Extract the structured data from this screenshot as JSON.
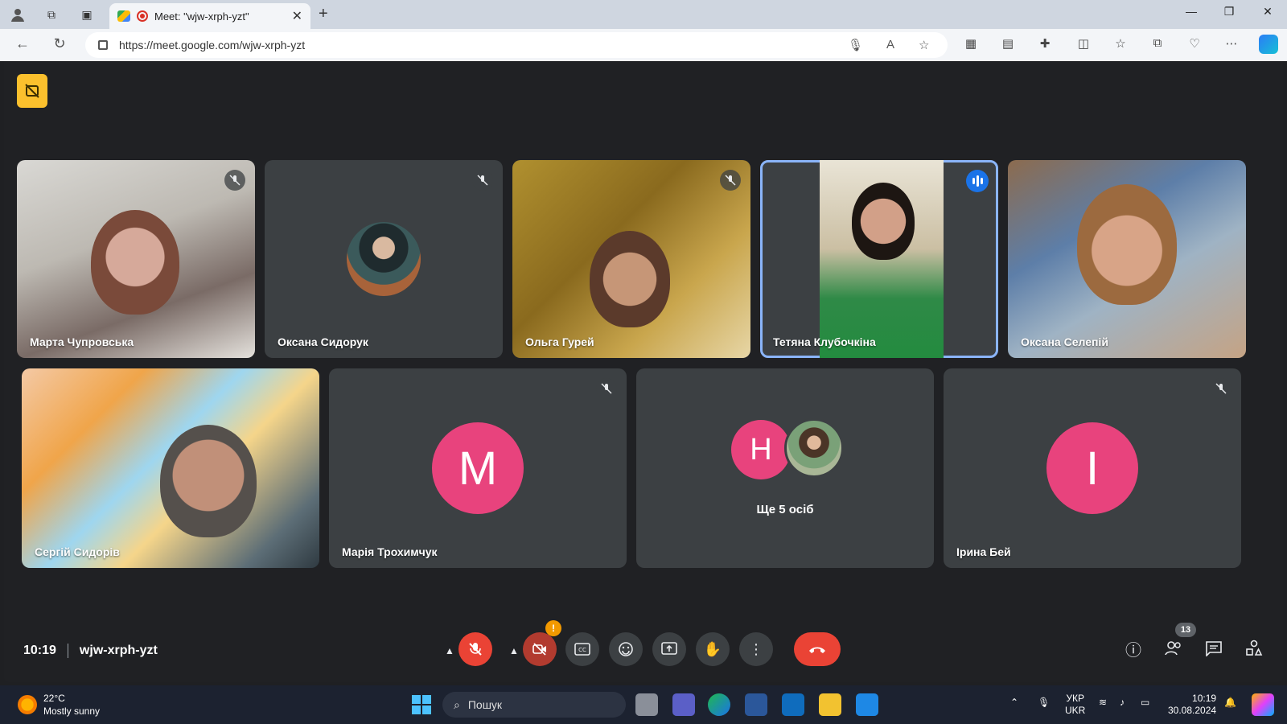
{
  "browser": {
    "tab_title": "Meet: \"wjw-xrph-yzt\"",
    "url": "https://meet.google.com/wjw-xrph-yzt",
    "new_tab_label": "+",
    "close_tab_glyph": "✕"
  },
  "participants": [
    {
      "name": "Марта Чупровська",
      "muted": true
    },
    {
      "name": "Оксана Сидорук",
      "muted": true
    },
    {
      "name": "Ольга Гурей",
      "muted": true
    },
    {
      "name": "Тетяна Клубочкіна",
      "speaking": true
    },
    {
      "name": "Оксана Селепій",
      "muted": false
    },
    {
      "name": "Сергій Сидорів",
      "muted": false
    },
    {
      "name": "Марія Трохимчук",
      "muted": true,
      "initial": "М"
    },
    {
      "name": "Ірина Бей",
      "muted": true,
      "initial": "І"
    }
  ],
  "more_tile": {
    "initial": "Н",
    "label": "Ще 5 осіб"
  },
  "meeting": {
    "time": "10:19",
    "code": "wjw-xrph-yzt",
    "people_count": "13",
    "camera_alert": "!"
  },
  "taskbar": {
    "temperature": "22°C",
    "weather_text": "Mostly sunny",
    "search_placeholder": "Пошук",
    "lang_top": "УКР",
    "lang_bottom": "UKR",
    "clock_time": "10:19",
    "clock_date": "30.08.2024"
  },
  "colors": {
    "meet_bg": "#202124",
    "tile_bg": "#3c4043",
    "avatar_pink": "#e8437d",
    "end_call_red": "#ea4335",
    "speaking_outline": "#8ab4f8",
    "no_caption_yellow": "#fbc02d"
  }
}
